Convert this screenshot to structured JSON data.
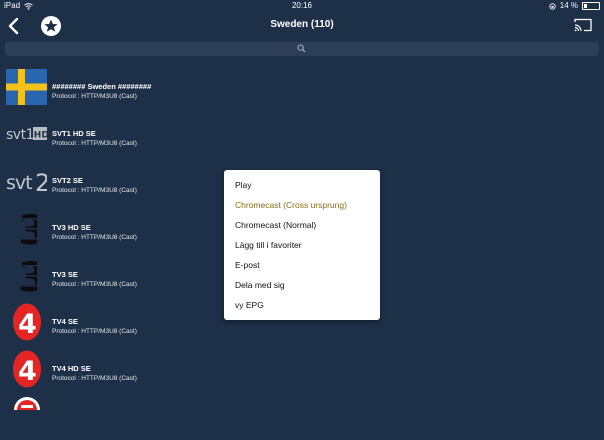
{
  "status_bar": {
    "device": "iPad",
    "time": "20:16",
    "battery": "14 %"
  },
  "nav": {
    "title": "Sweden (110)"
  },
  "search": {
    "placeholder": ""
  },
  "channels": [
    {
      "name": "########  Sweden  ########",
      "protocol": "Protocol : HTTP/M3U8 (Cast)",
      "logo": "sweden-flag-icon"
    },
    {
      "name": "SVT1 HD SE",
      "protocol": "Protocol : HTTP/M3U8 (Cast)",
      "logo": "svt1-hd-logo"
    },
    {
      "name": "SVT2 SE",
      "protocol": "Protocol : HTTP/M3U8 (Cast)",
      "logo": "svt2-logo"
    },
    {
      "name": "TV3 HD SE",
      "protocol": "Protocol : HTTP/M3U8 (Cast)",
      "logo": "tv3-logo"
    },
    {
      "name": "TV3 SE",
      "protocol": "Protocol : HTTP/M3U8 (Cast)",
      "logo": "tv3-logo"
    },
    {
      "name": "TV4 SE",
      "protocol": "Protocol : HTTP/M3U8 (Cast)",
      "logo": "tv4-logo"
    },
    {
      "name": "TV4 HD SE",
      "protocol": "Protocol : HTTP/M3U8 (Cast)",
      "logo": "tv4-logo"
    }
  ],
  "menu": {
    "items": [
      "Play",
      "Chromecast (Cross ursprung)",
      "Chromecast (Normal)",
      "Lägg till i favoriter",
      "E-post",
      "Dela med sig",
      "vy EPG"
    ],
    "highlighted_index": 1,
    "highlight_color": "#8a6a16"
  },
  "colors": {
    "background": "#1e3048",
    "search_bar": "#2d3f56",
    "tv4_red": "#e42524",
    "svt_grey": "#b8bcc2"
  }
}
